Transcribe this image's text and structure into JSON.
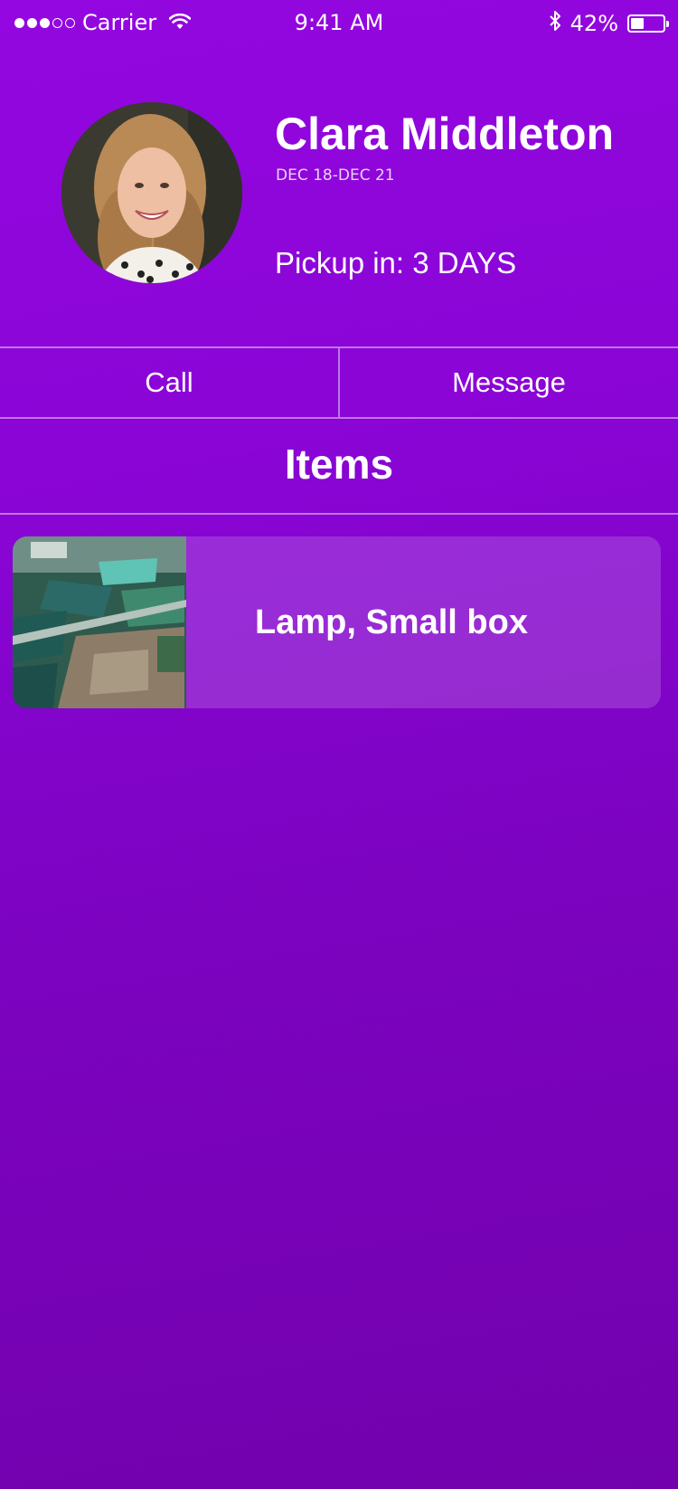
{
  "status_bar": {
    "carrier": "Carrier",
    "time": "9:41 AM",
    "battery": "42%",
    "battery_level": 0.42,
    "signal_bars_filled": 3,
    "signal_bars_total": 5
  },
  "profile": {
    "name": "Clara Middleton",
    "dates": "DEC 18-DEC 21",
    "pickup": "Pickup in: 3 DAYS"
  },
  "actions": {
    "call_label": "Call",
    "message_label": "Message"
  },
  "items_section": {
    "title": "Items",
    "items": [
      {
        "label": "Lamp, Small box",
        "image": "aerial-landscape-photo"
      }
    ]
  },
  "colors": {
    "background_top": "#9407e0",
    "background_bottom": "#7201ad",
    "text": "#ffffff"
  }
}
